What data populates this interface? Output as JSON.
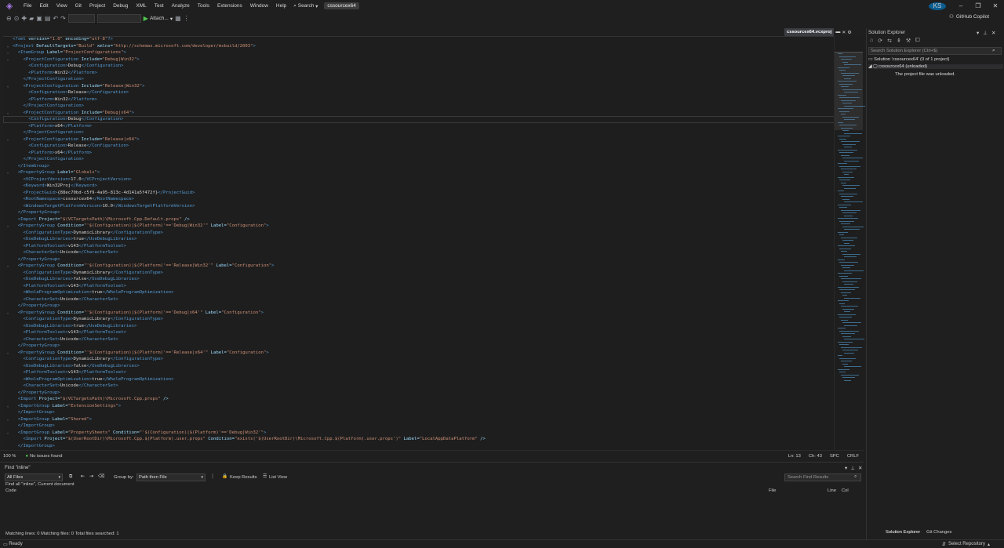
{
  "menu": [
    "File",
    "Edit",
    "View",
    "Git",
    "Project",
    "Debug",
    "XML",
    "Test",
    "Analyze",
    "Tools",
    "Extensions",
    "Window",
    "Help"
  ],
  "search_label": "Search",
  "project_name": "cssourcex64",
  "account_initials": "KS",
  "copilot_label": "GitHub Copilot",
  "toolbar": {
    "attach_label": "Attach..."
  },
  "editor": {
    "tab_label": "cssourcex64.vcxproj",
    "zoom": "100 %",
    "issues": "No issues found",
    "line": "Ln: 13",
    "col": "Ch: 43",
    "spc": "SPC",
    "eol": "CRLF"
  },
  "code_lines": [
    "<?xml version=\"1.0\" encoding=\"utf-8\"?>",
    "<Project DefaultTargets=\"Build\" xmlns=\"http://schemas.microsoft.com/developer/msbuild/2003\">",
    "  <ItemGroup Label=\"ProjectConfigurations\">",
    "    <ProjectConfiguration Include=\"Debug|Win32\">",
    "      <Configuration>Debug</Configuration>",
    "      <Platform>Win32</Platform>",
    "    </ProjectConfiguration>",
    "    <ProjectConfiguration Include=\"Release|Win32\">",
    "      <Configuration>Release</Configuration>",
    "      <Platform>Win32</Platform>",
    "    </ProjectConfiguration>",
    "    <ProjectConfiguration Include=\"Debug|x64\">",
    "      <Configuration>Debug</Configuration>",
    "      <Platform>x64</Platform>",
    "    </ProjectConfiguration>",
    "    <ProjectConfiguration Include=\"Release|x64\">",
    "      <Configuration>Release</Configuration>",
    "      <Platform>x64</Platform>",
    "    </ProjectConfiguration>",
    "  </ItemGroup>",
    "  <PropertyGroup Label=\"Globals\">",
    "    <VCProjectVersion>17.0</VCProjectVersion>",
    "    <Keyword>Win32Proj</Keyword>",
    "    <ProjectGuid>{88ec70bd-c5f9-4a95-813c-4d141a5f472f}</ProjectGuid>",
    "    <RootNamespace>cssourcex64</RootNamespace>",
    "    <WindowsTargetPlatformVersion>10.0</WindowsTargetPlatformVersion>",
    "  </PropertyGroup>",
    "  <Import Project=\"$(VCTargetsPath)\\Microsoft.Cpp.Default.props\" />",
    "  <PropertyGroup Condition=\"'$(Configuration)|$(Platform)'=='Debug|Win32'\" Label=\"Configuration\">",
    "    <ConfigurationType>DynamicLibrary</ConfigurationType>",
    "    <UseDebugLibraries>true</UseDebugLibraries>",
    "    <PlatformToolset>v143</PlatformToolset>",
    "    <CharacterSet>Unicode</CharacterSet>",
    "  </PropertyGroup>",
    "  <PropertyGroup Condition=\"'$(Configuration)|$(Platform)'=='Release|Win32'\" Label=\"Configuration\">",
    "    <ConfigurationType>DynamicLibrary</ConfigurationType>",
    "    <UseDebugLibraries>false</UseDebugLibraries>",
    "    <PlatformToolset>v143</PlatformToolset>",
    "    <WholeProgramOptimization>true</WholeProgramOptimization>",
    "    <CharacterSet>Unicode</CharacterSet>",
    "  </PropertyGroup>",
    "  <PropertyGroup Condition=\"'$(Configuration)|$(Platform)'=='Debug|x64'\" Label=\"Configuration\">",
    "    <ConfigurationType>DynamicLibrary</ConfigurationType>",
    "    <UseDebugLibraries>true</UseDebugLibraries>",
    "    <PlatformToolset>v143</PlatformToolset>",
    "    <CharacterSet>Unicode</CharacterSet>",
    "  </PropertyGroup>",
    "  <PropertyGroup Condition=\"'$(Configuration)|$(Platform)'=='Release|x64'\" Label=\"Configuration\">",
    "    <ConfigurationType>DynamicLibrary</ConfigurationType>",
    "    <UseDebugLibraries>false</UseDebugLibraries>",
    "    <PlatformToolset>v143</PlatformToolset>",
    "    <WholeProgramOptimization>true</WholeProgramOptimization>",
    "    <CharacterSet>Unicode</CharacterSet>",
    "  </PropertyGroup>",
    "  <Import Project=\"$(VCTargetsPath)\\Microsoft.Cpp.props\" />",
    "  <ImportGroup Label=\"ExtensionSettings\">",
    "  </ImportGroup>",
    "  <ImportGroup Label=\"Shared\">",
    "  </ImportGroup>",
    "  <ImportGroup Label=\"PropertySheets\" Condition=\"'$(Configuration)|$(Platform)'=='Debug|Win32'\">",
    "    <Import Project=\"$(UserRootDir)\\Microsoft.Cpp.$(Platform).user.props\" Condition=\"exists('$(UserRootDir)\\Microsoft.Cpp.$(Platform).user.props')\" Label=\"LocalAppDataPlatform\" />",
    "  </ImportGroup>",
    "  <ImportGroup Label=\"PropertySheets\" Condition=\"'$(Configuration)|$(Platform)'=='Release|Win32'\">"
  ],
  "find": {
    "title": "Find \"inline\"",
    "scope": "All Files",
    "group_by_label": "Group by:",
    "group_by_value": "Path then File",
    "keep_results": "Keep Results",
    "list_view": "List View",
    "search_placeholder": "Search Find Results",
    "summary": "Find all \"inline\", Current document",
    "col_code": "Code",
    "col_file": "File",
    "col_line": "Line",
    "col_col": "Col",
    "footer": "Matching lines: 0 Matching files: 0 Total files searched: 1"
  },
  "solution_explorer": {
    "title": "Solution Explorer",
    "search_placeholder": "Search Solution Explorer (Ctrl+$)",
    "solution_item": "Solution 'cssourcex64' (0 of 1 project)",
    "project_item": "cssourcex64 (unloaded)",
    "unloaded_msg": "The project file was unloaded.",
    "tab_solution": "Solution Explorer",
    "tab_git": "Git Changes"
  },
  "status": {
    "ready": "Ready",
    "repo": "Select Repository"
  }
}
